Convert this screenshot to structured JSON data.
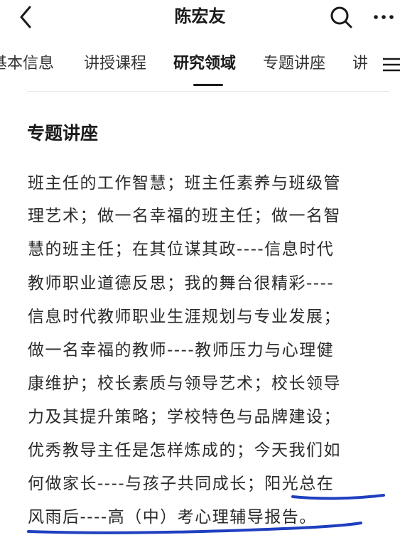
{
  "header": {
    "back_icon": "chevron-left-icon",
    "title": "陈宏友",
    "search_icon": "search-icon",
    "more_icon": "more-horizontal-icon"
  },
  "tabs": {
    "items": [
      {
        "label": "基本信息",
        "active": false
      },
      {
        "label": "讲授课程",
        "active": false
      },
      {
        "label": "研究领域",
        "active": true
      },
      {
        "label": "专题讲座",
        "active": false
      },
      {
        "label": "讲",
        "active": false
      }
    ],
    "menu_icon": "menu-icon"
  },
  "section": {
    "title": "专题讲座",
    "lines": [
      "班主任的工作智慧；班主任素养与班级管",
      "理艺术；做一名幸福的班主任；做一名智",
      "慧的班主任；在其位谋其政----信息时代",
      "教师职业道德反思；我的舞台很精彩----",
      "信息时代教师职业生涯规划与专业发展；",
      "做一名幸福的教师----教师压力与心理健",
      "康维护；校长素质与领导艺术；校长领导",
      "力及其提升策略；学校特色与品牌建设；",
      "优秀教导主任是怎样炼成的；今天我们如",
      "何做家长----与孩子共同成长；阳光总在",
      "风雨后----高（中）考心理辅导报告。"
    ]
  },
  "colors": {
    "annotation_underline": "#1f3fbf",
    "text": "#2a2a2a",
    "divider": "#e6e6e6"
  }
}
